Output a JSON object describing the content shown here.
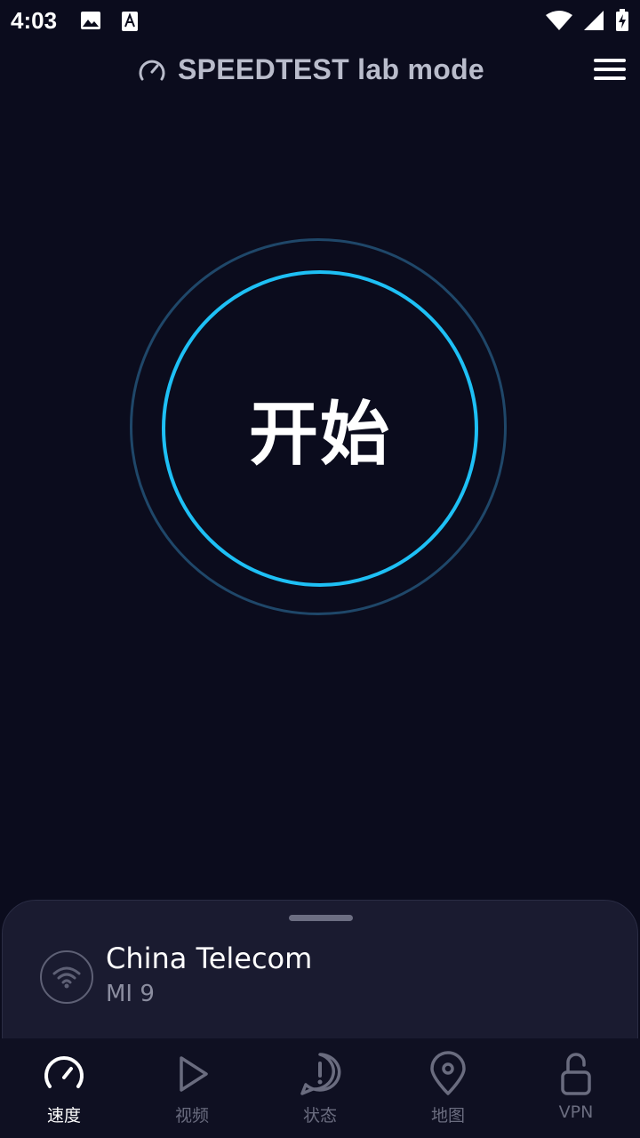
{
  "status_bar": {
    "time": "4:03"
  },
  "header": {
    "title": "SPEEDTEST lab mode"
  },
  "start": {
    "label": "开始"
  },
  "connection": {
    "provider": "China Telecom",
    "device": "MI 9"
  },
  "nav": {
    "items": [
      {
        "label": "速度",
        "icon": "speedometer-icon",
        "active": true
      },
      {
        "label": "视频",
        "icon": "play-icon",
        "active": false
      },
      {
        "label": "状态",
        "icon": "alert-icon",
        "active": false
      },
      {
        "label": "地图",
        "icon": "map-pin-icon",
        "active": false
      },
      {
        "label": "VPN",
        "icon": "unlock-icon",
        "active": false
      }
    ]
  },
  "colors": {
    "background": "#0b0c1d",
    "accent_ring": "#1ec0f5",
    "outer_ring": "#1f4769",
    "sheet": "#1a1b30",
    "nav_inactive": "#6a6c7f"
  }
}
